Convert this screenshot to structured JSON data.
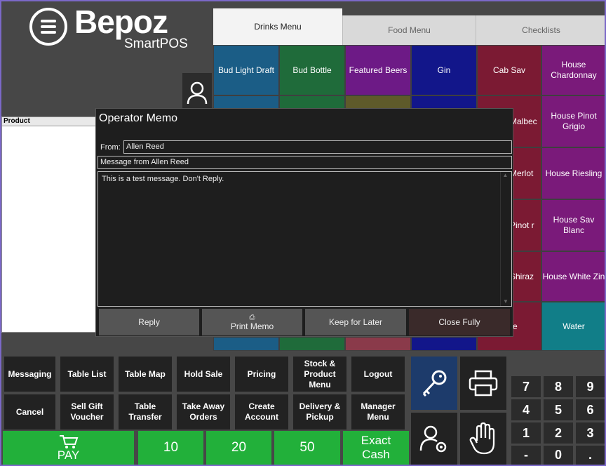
{
  "logo": {
    "brand": "Bepoz",
    "product": "SmartPOS"
  },
  "product_panel": {
    "header": "Product"
  },
  "tabs": [
    {
      "label": "Drinks Menu"
    },
    {
      "label": "Food Menu"
    },
    {
      "label": "Checklists"
    }
  ],
  "tiles_row1": [
    {
      "label": "Bud Light Draft",
      "color": "#1b5d86"
    },
    {
      "label": "Bud Bottle",
      "color": "#1f6b3a"
    },
    {
      "label": "Featured Beers",
      "color": "#6d1a86"
    },
    {
      "label": "Gin",
      "color": "#12168a"
    },
    {
      "label": "Cab Sav",
      "color": "#7b1a33"
    },
    {
      "label": "House Chardonnay",
      "color": "#7a1a7a"
    }
  ],
  "tiles_col5": [
    {
      "label": "Malbec"
    },
    {
      "label": "Merlot"
    },
    {
      "label": "Pinot r"
    },
    {
      "label": "Shiraz"
    },
    {
      "label": "e"
    }
  ],
  "tiles_col6": [
    {
      "label": "House Pinot Grigio",
      "color": "#7a1a7a"
    },
    {
      "label": "House Riesling",
      "color": "#7a1a7a"
    },
    {
      "label": "House Sav Blanc",
      "color": "#7a1a7a"
    },
    {
      "label": "House White Zin",
      "color": "#7a1a7a"
    },
    {
      "label": "Water",
      "color": "#117e88"
    }
  ],
  "memo": {
    "title": "Operator Memo",
    "from_label": "From:",
    "from_value": "Allen  Reed",
    "subject": "Message from Allen  Reed",
    "body": "This is a test message. Don't Reply.",
    "buttons": {
      "reply": "Reply",
      "print": "Print Memo",
      "keep": "Keep for Later",
      "close": "Close Fully"
    }
  },
  "functions_row1": [
    "Messaging",
    "Table List",
    "Table Map",
    "Hold Sale",
    "Pricing",
    "Stock & Product Menu",
    "Logout"
  ],
  "functions_row2": [
    "Cancel",
    "Sell Gift Voucher",
    "Table Transfer",
    "Take Away Orders",
    "Create Account",
    "Delivery & Pickup",
    "Manager Menu"
  ],
  "payment": {
    "pay": "PAY",
    "v10": "10",
    "v20": "20",
    "v50": "50",
    "exact": "Exact Cash"
  },
  "keypad": [
    "7",
    "8",
    "9",
    "4",
    "5",
    "6",
    "1",
    "2",
    "3",
    "-",
    "0",
    "."
  ],
  "icons": {
    "user": "user-icon",
    "key": "key-icon",
    "printer": "printer-icon",
    "user_settings": "user-settings-icon",
    "hand": "hand-icon",
    "cart": "cart-icon"
  }
}
